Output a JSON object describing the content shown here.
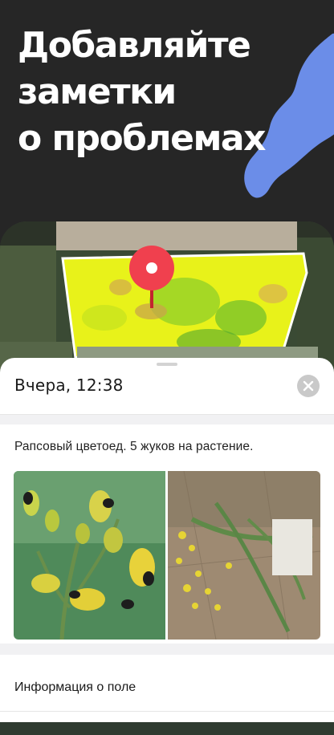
{
  "hero": {
    "lines": [
      "Добавляйте",
      "заметки",
      "о проблемах"
    ]
  },
  "note": {
    "date": "Вчера, 12:38",
    "text": "Рапсовый цветоед. 5 жуков на растение."
  },
  "info_row": {
    "label": "Информация о поле"
  },
  "icons": {
    "pin": "map-pin-icon",
    "close": "close-icon"
  },
  "colors": {
    "background": "#262626",
    "pin": "#f0404e",
    "field_overlay": "#e8f21a",
    "accent_blob": "#6b8de8"
  }
}
